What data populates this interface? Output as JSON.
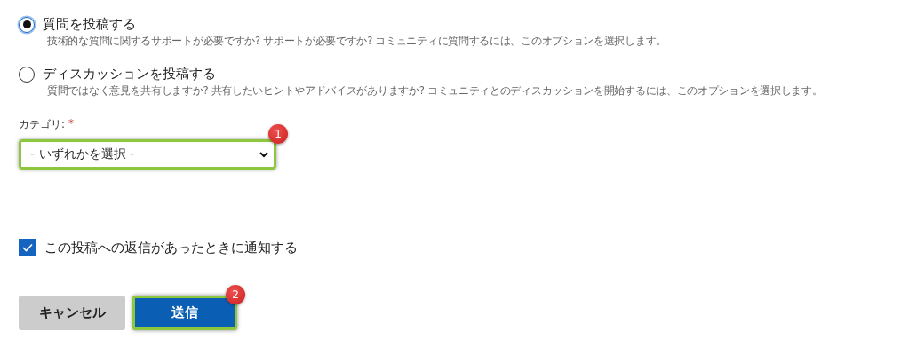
{
  "post_types": [
    {
      "title": "質問を投稿する",
      "description": "技術的な質問に関するサポートが必要ですか? サポートが必要ですか? コミュニティに質問するには、このオプションを選択します。",
      "selected": true
    },
    {
      "title": "ディスカッションを投稿する",
      "description": "質問ではなく意見を共有しますか? 共有したいヒントやアドバイスがありますか? コミュニティとのディスカッションを開始するには、このオプションを選択します。",
      "selected": false
    }
  ],
  "category": {
    "label": "カテゴリ:",
    "required_mark": "*",
    "value": "- いずれかを選択 -",
    "highlighted": true,
    "marker": "1"
  },
  "notify": {
    "label": "この投稿への返信があったときに通知する",
    "checked": true
  },
  "buttons": [
    {
      "kind": "secondary",
      "label": "キャンセル",
      "highlighted": false
    },
    {
      "kind": "primary",
      "label": "送信",
      "highlighted": true,
      "marker": "2"
    }
  ]
}
